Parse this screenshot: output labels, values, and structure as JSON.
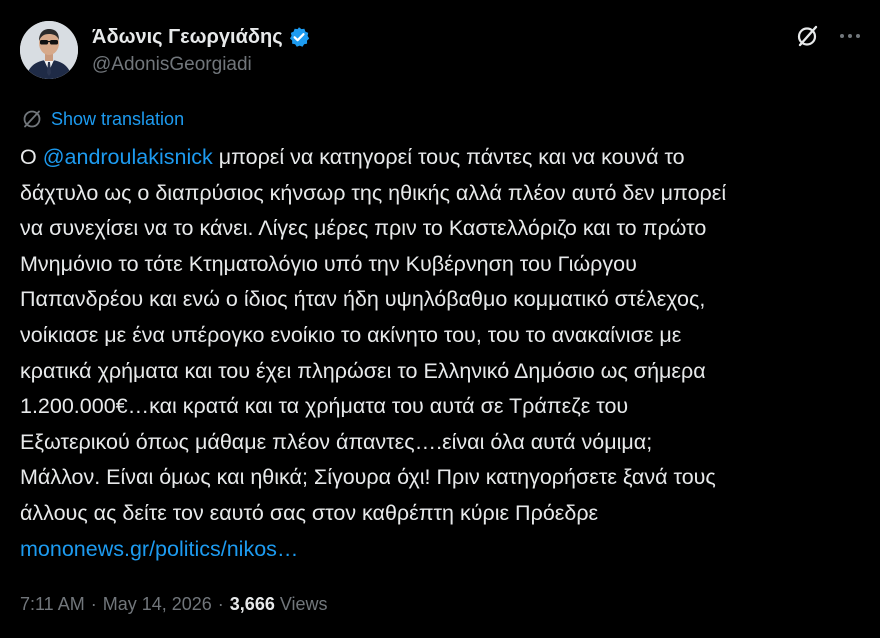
{
  "author": {
    "display_name": "Άδωνις Γεωργιάδης",
    "handle": "@AdonisGeorgiadi",
    "verified": true,
    "verified_color": "#1d9bf0",
    "avatar_icon": "profile-photo"
  },
  "actions": {
    "grok_icon": "grok-icon",
    "more_icon": "more-icon"
  },
  "translation": {
    "icon": "translate-globe-icon",
    "label": "Show translation"
  },
  "tweet": {
    "lines": [
      {
        "prefix": "Ο ",
        "mention": "@androulakisnick",
        "suffix": " μπορεί να κατηγορεί τους πάντες και να κουνά το"
      },
      {
        "text": "δάχτυλο ως ο διαπρύσιος κήνσωρ της ηθικής αλλά πλέον αυτό δεν μπορεί"
      },
      {
        "text": "να συνεχίσει να το κάνει. Λίγες μέρες πριν το Καστελλόριζο και το πρώτο"
      },
      {
        "text": "Μνημόνιο το τότε Κτηματολόγιο υπό την Κυβέρνηση του Γιώργου"
      },
      {
        "text": "Παπανδρέου και ενώ ο ίδιος ήταν ήδη υψηλόβαθμο κομματικό στέλεχος,"
      },
      {
        "text": "νοίκιασε με ένα υπέρογκο ενοίκιο το ακίνητο του, του το ανακαίνισε με"
      },
      {
        "text": "κρατικά χρήματα και του έχει πληρώσει το Ελληνικό Δημόσιο ως σήμερα"
      },
      {
        "text": "1.200.000€…και κρατά και τα χρήματα του αυτά σε Τράπεζε του"
      },
      {
        "text": "Εξωτερικού όπως μάθαμε πλέον άπαντες….είναι όλα αυτά νόμιμα;"
      },
      {
        "text": "Μάλλον. Είναι όμως και ηθικά; Σίγουρα όχι! Πριν κατηγορήσετε ξανά τους"
      },
      {
        "text": "άλλους ας δείτε τον εαυτό σας στον καθρέπτη κύριε Πρόεδρε"
      }
    ],
    "link_text": "mononews.gr/politics/nikos…"
  },
  "meta": {
    "time": "7:11 AM",
    "date": "May 14, 2026",
    "separator": "·",
    "views_count": "3,666",
    "views_label": "Views"
  },
  "colors": {
    "background": "#000000",
    "text": "#e7e9ea",
    "secondary": "#71767b",
    "accent": "#1d9bf0"
  }
}
